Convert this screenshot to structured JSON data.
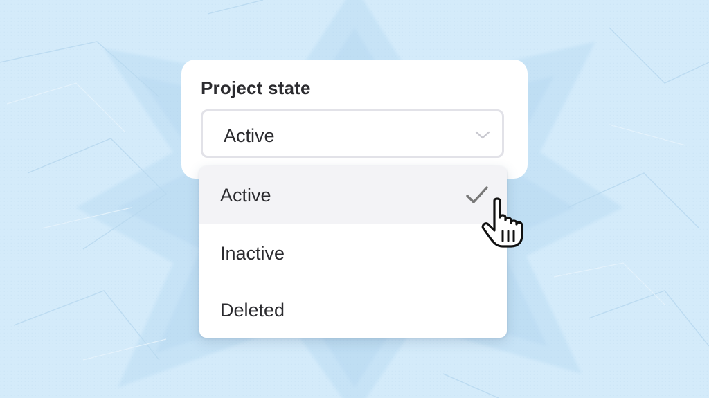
{
  "project_state": {
    "label": "Project state",
    "selected_value": "Active",
    "options": [
      {
        "label": "Active",
        "selected": true
      },
      {
        "label": "Inactive",
        "selected": false
      },
      {
        "label": "Deleted",
        "selected": false
      }
    ]
  },
  "icons": {
    "chevron": "chevron-down-icon",
    "check": "check-icon",
    "cursor": "hand-pointer-cursor-icon"
  },
  "colors": {
    "background": "#d4ebfa",
    "card": "#ffffff",
    "text": "#2b2b2f",
    "selected_row": "#f3f3f6",
    "check": "#777777"
  }
}
